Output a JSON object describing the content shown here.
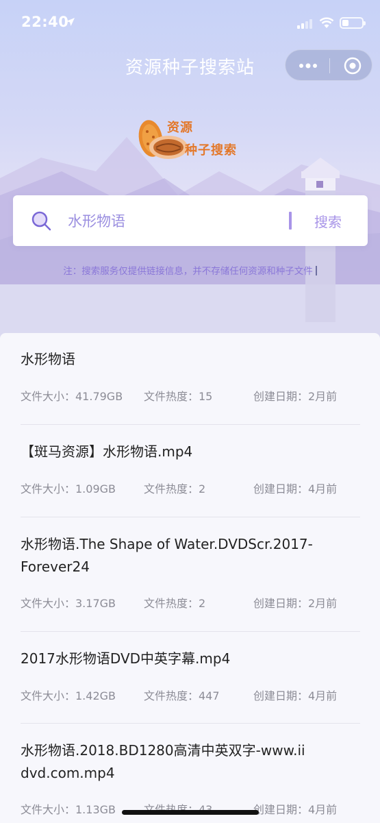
{
  "status_bar": {
    "time": "22:40"
  },
  "nav": {
    "title": "资源种子搜索站"
  },
  "logo": {
    "line1": "资源",
    "line2": "种子搜索"
  },
  "search": {
    "value": "水形物语",
    "button_label": "搜索"
  },
  "notice": "注：搜索服务仅提供链接信息，并不存储任何资源和种子文件",
  "results": [
    {
      "title": "水形物语",
      "size": "文件大小：41.79GB",
      "heat": "文件热度：15",
      "date": "创建日期：2月前"
    },
    {
      "title": "【斑马资源】水形物语.mp4",
      "size": "文件大小：1.09GB",
      "heat": "文件热度：2",
      "date": "创建日期：4月前"
    },
    {
      "title": "水形物语.The Shape of Water.DVDScr.2017-Forever24",
      "size": "文件大小：3.17GB",
      "heat": "文件热度：2",
      "date": "创建日期：2月前"
    },
    {
      "title": "2017水形物语DVD中英字幕.mp4",
      "size": "文件大小：1.42GB",
      "heat": "文件热度：447",
      "date": "创建日期：4月前"
    },
    {
      "title": "水形物语.2018.BD1280高清中英双字-www.iidvd.com.mp4",
      "size": "文件大小：1.13GB",
      "heat": "文件热度：43",
      "date": "创建日期：4月前"
    }
  ],
  "colors": {
    "accent": "#a894e8",
    "logo_orange": "#e3782a"
  },
  "icons": [
    "location-arrow-icon",
    "signal-icon",
    "wifi-icon",
    "battery-icon",
    "more-dots-icon",
    "target-close-icon",
    "search-icon"
  ]
}
